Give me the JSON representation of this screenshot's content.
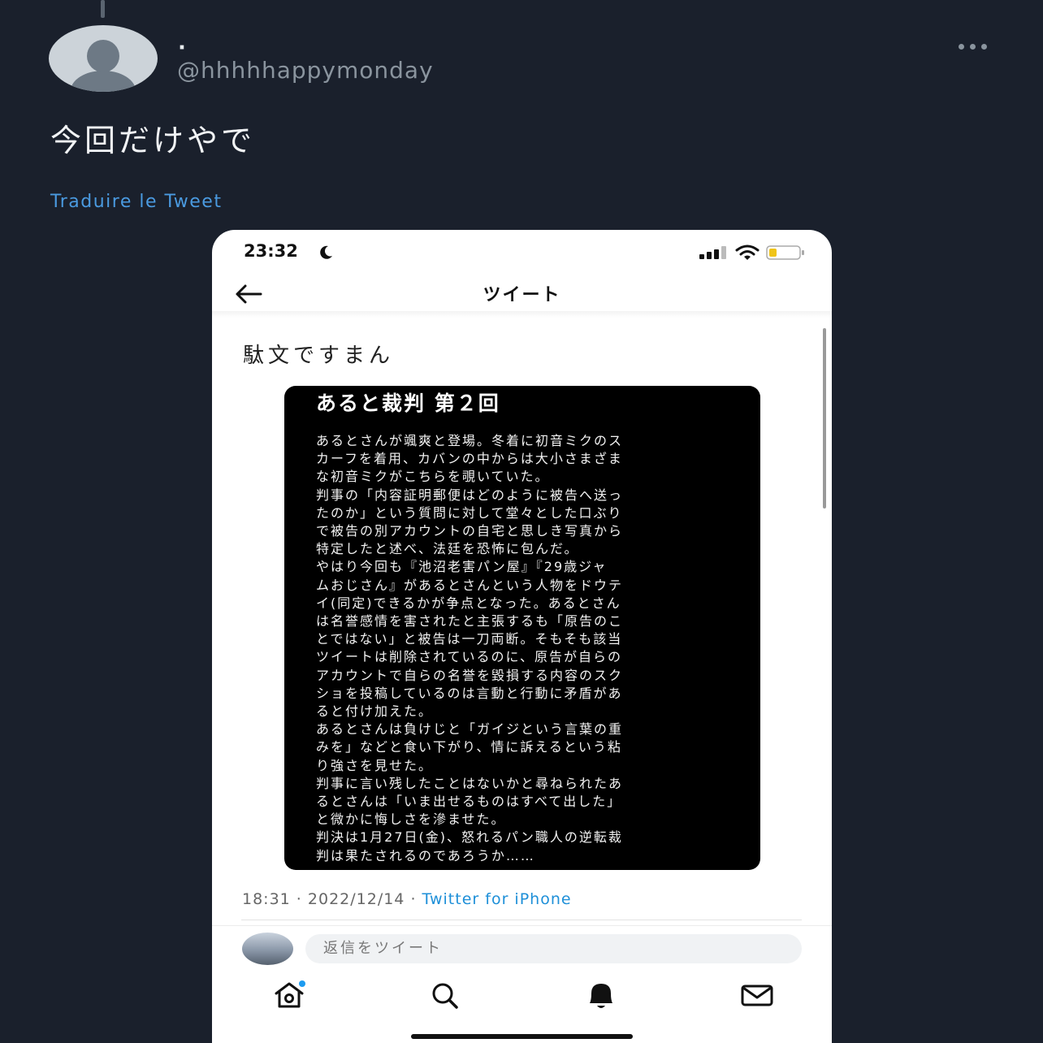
{
  "tweet": {
    "display_name": "·",
    "handle": "@hhhhhappymonday",
    "text": "今回だけやで",
    "translate_label": "Traduire le Tweet"
  },
  "screenshot": {
    "status": {
      "time": "23:32"
    },
    "nav": {
      "title": "ツイート"
    },
    "tweet_text": "駄文ですまん",
    "document": {
      "title": "あると裁判 第２回",
      "lines": [
        "あるとさんが颯爽と登場。冬着に初音ミクのス",
        "カーフを着用、カバンの中からは大小さまざま",
        "な初音ミクがこちらを覗いていた。",
        "判事の「内容証明郵便はどのように被告へ送っ",
        "たのか」という質問に対して堂々とした口ぶり",
        "で被告の別アカウントの自宅と思しき写真から",
        "特定したと述べ、法廷を恐怖に包んだ。",
        "やはり今回も『池沼老害パン屋』『29歳ジャ",
        "ムおじさん』があるとさんという人物をドウテ",
        "イ(同定)できるかが争点となった。あるとさん",
        "は名誉感情を害されたと主張するも「原告のこ",
        "とではない」と被告は一刀両断。そもそも該当",
        "ツイートは削除されているのに、原告が自らの",
        "アカウントで自らの名誉を毀損する内容のスク",
        "ショを投稿しているのは言動と行動に矛盾があ",
        "ると付け加えた。",
        "あるとさんは負けじと「ガイジという言葉の重",
        "みを」などと食い下がり、情に訴えるという粘",
        "り強さを見せた。",
        "判事に言い残したことはないかと尋ねられたあ",
        "るとさんは「いま出せるものはすべて出した」",
        "と微かに悔しさを滲ませた。",
        "判決は1月27日(金)、怒れるパン職人の逆転裁",
        "判は果たされるのであろうか……"
      ]
    },
    "meta": {
      "time": "18:31",
      "separator": " · ",
      "date": "2022/12/14",
      "source": "Twitter for iPhone"
    },
    "reply_placeholder": "返信をツイート",
    "icons": [
      "home-icon",
      "search-icon",
      "bell-icon",
      "mail-icon"
    ],
    "colors": {
      "link": "#1d8fd8",
      "accent": "#4a9ae0"
    }
  }
}
